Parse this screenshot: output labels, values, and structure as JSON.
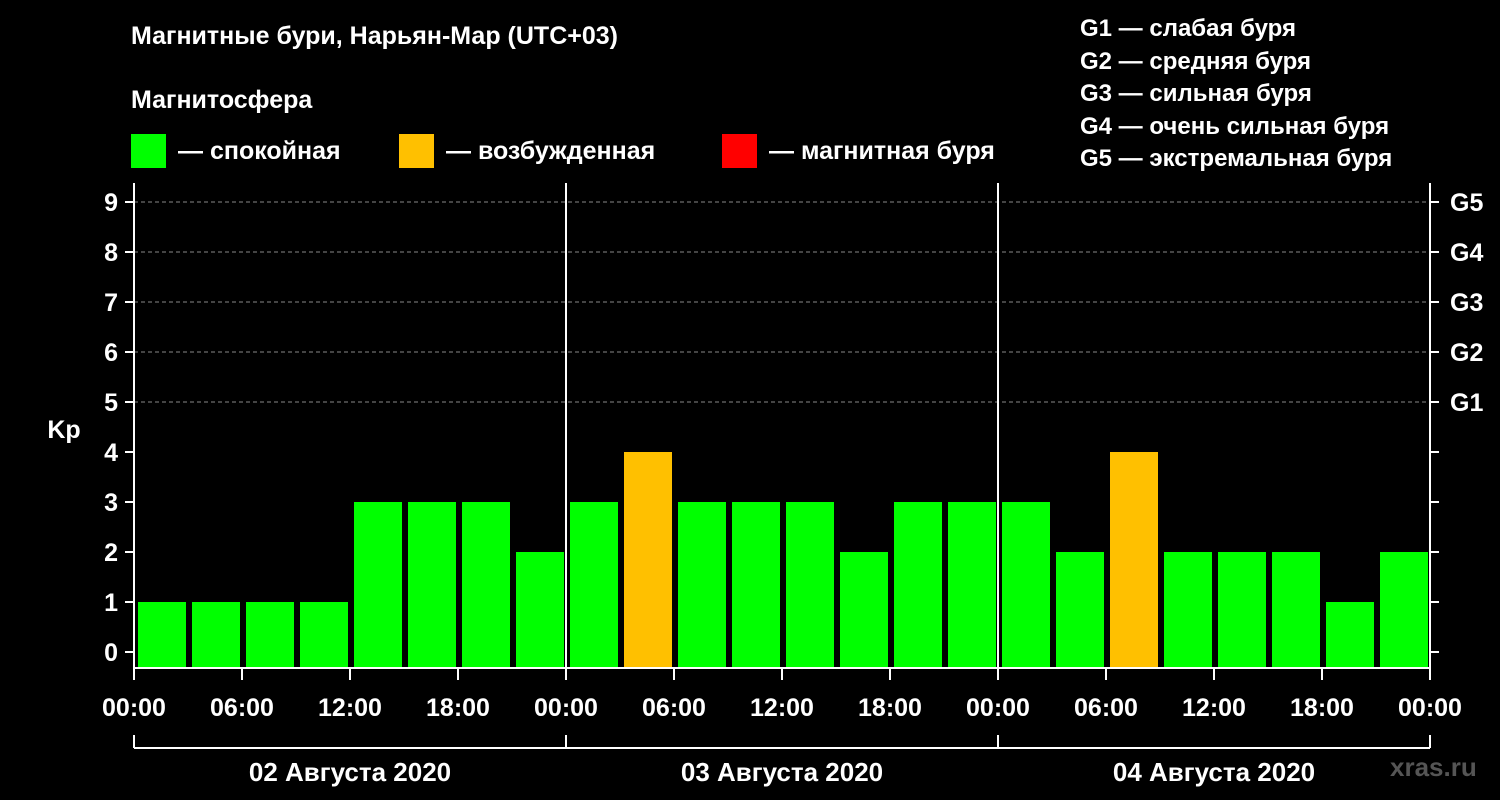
{
  "chart_data": {
    "type": "bar",
    "title": "Магнитные бури, Нарьян-Мар (UTC+03)",
    "subtitle": "Магнитосфера",
    "ylabel": "Kp",
    "ylim": [
      0,
      9
    ],
    "yticks": [
      "0",
      "1",
      "2",
      "3",
      "4",
      "5",
      "6",
      "7",
      "8",
      "9"
    ],
    "right_ticks": [
      {
        "value": 5,
        "label": "G1"
      },
      {
        "value": 6,
        "label": "G2"
      },
      {
        "value": 7,
        "label": "G3"
      },
      {
        "value": 8,
        "label": "G4"
      },
      {
        "value": 9,
        "label": "G5"
      }
    ],
    "xtick_labels": [
      "00:00",
      "06:00",
      "12:00",
      "18:00",
      "00:00",
      "06:00",
      "12:00",
      "18:00",
      "00:00",
      "06:00",
      "12:00",
      "18:00",
      "00:00"
    ],
    "days": [
      "02 Августа 2020",
      "03 Августа 2020",
      "04 Августа 2020"
    ],
    "interval_hours": 3,
    "grid": "dashed horizontal lines at Kp 5–9",
    "values": [
      1,
      1,
      1,
      1,
      3,
      3,
      3,
      2,
      3,
      4,
      3,
      3,
      3,
      2,
      3,
      3,
      3,
      2,
      4,
      2,
      2,
      2,
      1,
      2
    ]
  },
  "legend": [
    {
      "label": "— спокойная",
      "color": "#00ff00"
    },
    {
      "label": "— возбужденная",
      "color": "#ffc000"
    },
    {
      "label": "— магнитная буря",
      "color": "#ff0000"
    }
  ],
  "scale": [
    "G1 — слабая буря",
    "G2 — средняя буря",
    "G3 — сильная буря",
    "G4 — очень сильная буря",
    "G5 — экстремальная буря"
  ],
  "colors": {
    "calm": "#00ff00",
    "excited": "#ffc000",
    "storm": "#ff0000"
  },
  "watermark": "xras.ru"
}
